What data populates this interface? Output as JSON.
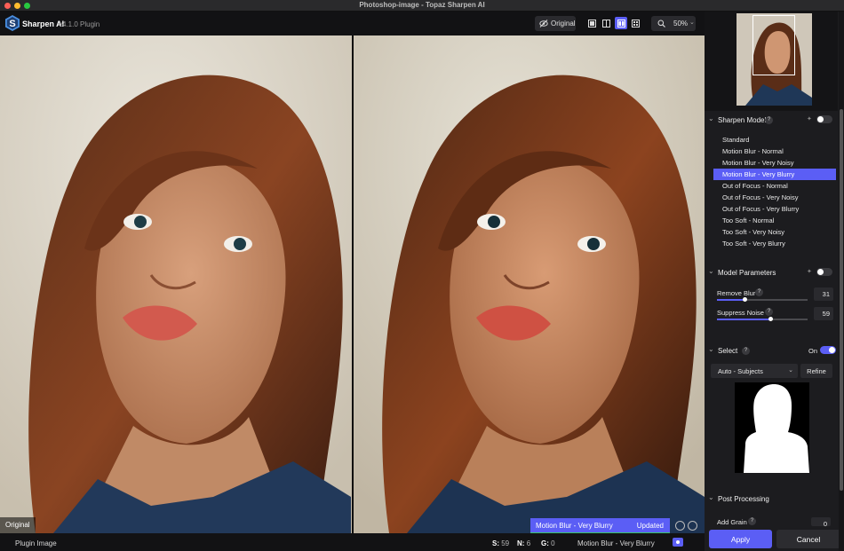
{
  "window": {
    "title": "Photoshop-image - Topaz Sharpen AI"
  },
  "app": {
    "name": "Sharpen AI",
    "version": "v4.1.0 Plugin"
  },
  "toolbar": {
    "original_label": "Original",
    "zoom_value": "50%"
  },
  "canvas": {
    "left_label": "Original",
    "model_bar": {
      "model": "Motion Blur - Very Blurry",
      "status": "Updated"
    }
  },
  "statusbar": {
    "plugin_label": "Plugin Image",
    "s_key": "S:",
    "s_val": "59",
    "n_key": "N:",
    "n_val": "6",
    "g_key": "G:",
    "g_val": "0",
    "model": "Motion Blur - Very Blurry"
  },
  "panel": {
    "sharpen_model": {
      "title": "Sharpen Model",
      "help": "?",
      "items": [
        "Standard",
        "Motion Blur - Normal",
        "Motion Blur - Very Noisy",
        "Motion Blur - Very Blurry",
        "Out of Focus - Normal",
        "Out of Focus - Very Noisy",
        "Out of Focus - Very Blurry",
        "Too Soft - Normal",
        "Too Soft - Very Noisy",
        "Too Soft - Very Blurry"
      ],
      "selected": "Motion Blur - Very Blurry"
    },
    "model_parameters": {
      "title": "Model Parameters",
      "remove_blur": {
        "label": "Remove Blur",
        "value": "31",
        "level": 0.31
      },
      "suppress_noise": {
        "label": "Suppress Noise",
        "value": "59",
        "level": 0.59
      }
    },
    "select": {
      "title": "Select",
      "state": "On",
      "mode": "Auto - Subjects",
      "refine": "Refine"
    },
    "post_processing": {
      "title": "Post Processing",
      "add_grain": {
        "label": "Add Grain",
        "value": "0"
      }
    },
    "apply": "Apply",
    "cancel": "Cancel"
  },
  "colors": {
    "accent": "#5b5ef5",
    "progress": "#39c36a",
    "panel_bg": "#1c1c1f"
  }
}
